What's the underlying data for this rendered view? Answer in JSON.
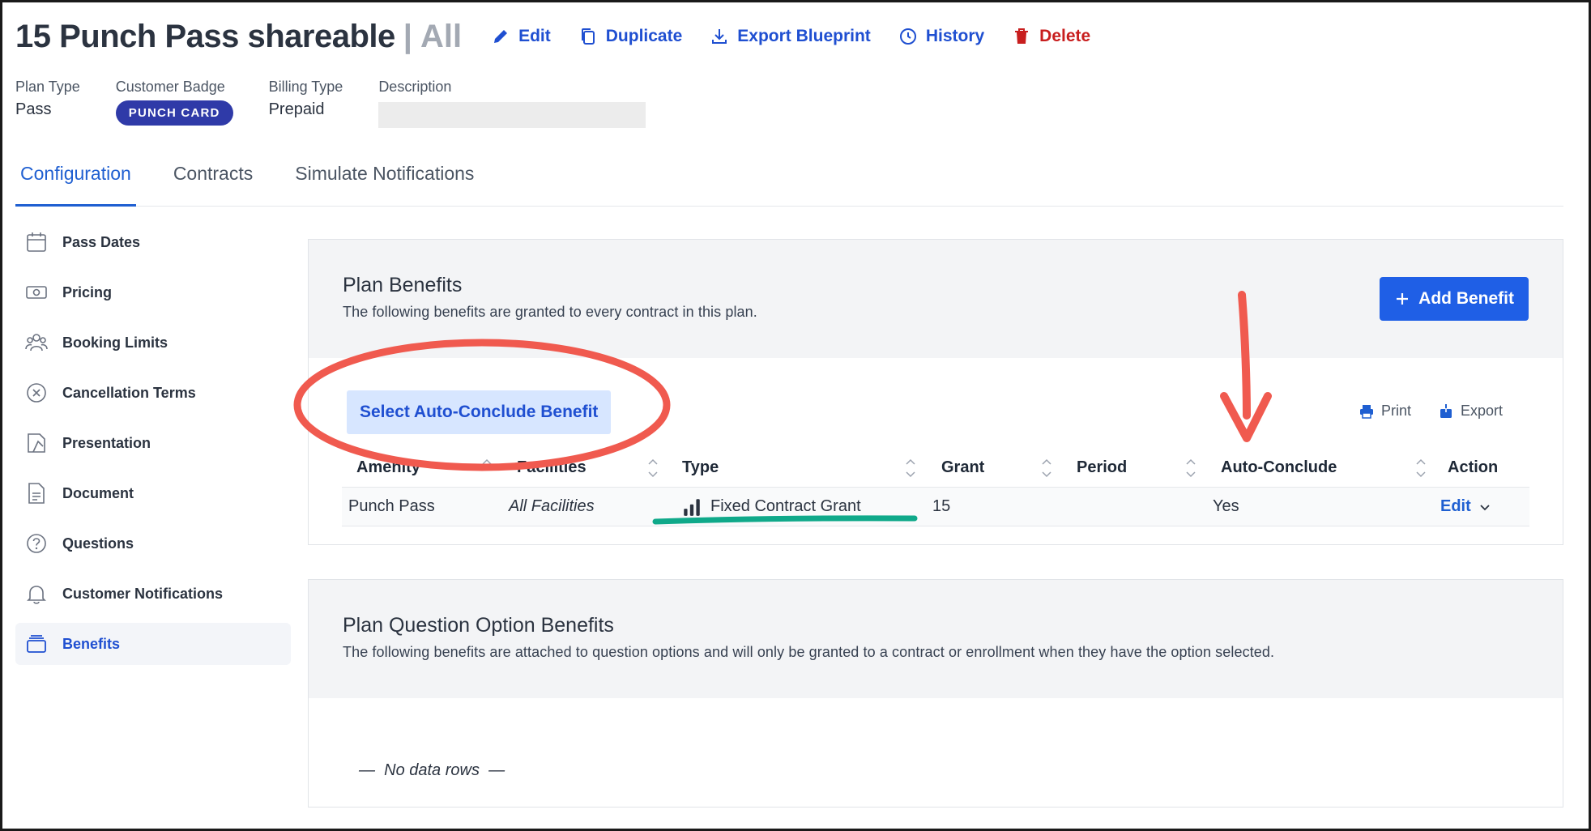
{
  "header": {
    "title": "15 Punch Pass shareable",
    "separator": "|",
    "scope": "All",
    "actions": {
      "edit": "Edit",
      "duplicate": "Duplicate",
      "export_blueprint": "Export Blueprint",
      "history": "History",
      "delete": "Delete"
    }
  },
  "meta": {
    "plan_type_label": "Plan Type",
    "plan_type_value": "Pass",
    "badge_label": "Customer Badge",
    "badge_value": "PUNCH CARD",
    "billing_label": "Billing Type",
    "billing_value": "Prepaid",
    "description_label": "Description"
  },
  "tabs": [
    {
      "label": "Configuration",
      "active": true
    },
    {
      "label": "Contracts",
      "active": false
    },
    {
      "label": "Simulate Notifications",
      "active": false
    }
  ],
  "sidebar": {
    "items": [
      {
        "label": "Pass Dates",
        "icon": "calendar-icon"
      },
      {
        "label": "Pricing",
        "icon": "money-icon"
      },
      {
        "label": "Booking Limits",
        "icon": "users-icon"
      },
      {
        "label": "Cancellation Terms",
        "icon": "cancel-circle-icon"
      },
      {
        "label": "Presentation",
        "icon": "presentation-icon"
      },
      {
        "label": "Document",
        "icon": "document-icon"
      },
      {
        "label": "Questions",
        "icon": "question-icon"
      },
      {
        "label": "Customer Notifications",
        "icon": "bell-icon"
      },
      {
        "label": "Benefits",
        "icon": "benefits-icon",
        "active": true
      }
    ]
  },
  "plan_benefits": {
    "title": "Plan Benefits",
    "subtitle": "The following benefits are granted to every contract in this plan.",
    "add_button": "Add Benefit",
    "auto_conclude_button": "Select Auto-Conclude Benefit",
    "print_label": "Print",
    "export_label": "Export",
    "columns": [
      "Amenity",
      "Facilities",
      "Type",
      "Grant",
      "Period",
      "Auto-Conclude",
      "Action"
    ],
    "rows": [
      {
        "amenity": "Punch Pass",
        "facilities": "All Facilities",
        "type": "Fixed Contract Grant",
        "grant": "15",
        "period": "",
        "auto_conclude": "Yes",
        "action": "Edit"
      }
    ]
  },
  "question_benefits": {
    "title": "Plan Question Option Benefits",
    "subtitle": "The following benefits are attached to question options and will only be granted to a contract or enrollment when they have the option selected.",
    "no_data": "No data rows"
  },
  "colors": {
    "accent": "#1f5fd1",
    "badge": "#2f3aa8",
    "danger": "#c81e1e",
    "annotation_red": "#f05a4f",
    "annotation_green": "#10a98a"
  }
}
